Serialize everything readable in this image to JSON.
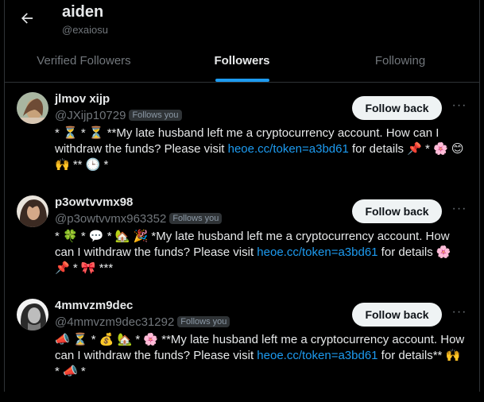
{
  "header": {
    "title": "aiden",
    "handle": "@exaiosu"
  },
  "tabs": [
    {
      "label": "Verified Followers"
    },
    {
      "label": "Followers"
    },
    {
      "label": "Following"
    }
  ],
  "follow_back_label": "Follow back",
  "follows_you_label": "Follows you",
  "colors": {
    "accent": "#1d9bf0",
    "background": "#000000",
    "muted": "#71767b"
  },
  "users": [
    {
      "name": "jlmov xijp",
      "handle": "@JXijp10729",
      "bio_pre": "* ⏳ * ⏳ **My late husband left me a cryptocurrency account. How can I withdraw the funds? Please visit ",
      "bio_link": "heoe.cc/token=a3bd61",
      "bio_post": " for details 📌 * 🌸 😊 🙌 ** 🕒 *"
    },
    {
      "name": "p3owtvvmx98",
      "handle": "@p3owtvvmx963352",
      "bio_pre": "* 🍀 * 💬 * 🏡 🎉 *My late husband left me a cryptocurrency account. How can I withdraw the funds? Please visit ",
      "bio_link": "heoe.cc/token=a3bd61",
      "bio_post": " for details 🌸 📌 * 🎀 ***"
    },
    {
      "name": "4mmvzm9dec",
      "handle": "@4mmvzm9dec31292",
      "bio_pre": "📣 ⏳ * 💰 🏡 * 🌸 **My late husband left me a cryptocurrency account. How can I withdraw the funds? Please visit ",
      "bio_link": "heoe.cc/token=a3bd61",
      "bio_post": " for details** 🙌 * 📣 *"
    }
  ]
}
